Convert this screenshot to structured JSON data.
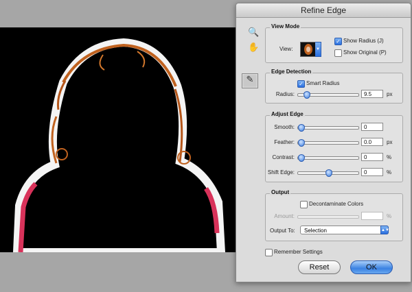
{
  "dialog": {
    "title": "Refine Edge"
  },
  "tools": [
    {
      "name": "zoom",
      "icon": "magnifier-icon",
      "glyph": "🔍"
    },
    {
      "name": "hand",
      "icon": "hand-icon",
      "glyph": "✋"
    },
    {
      "name": "refine-radius",
      "icon": "brush-icon",
      "glyph": "✎"
    }
  ],
  "view_mode": {
    "title": "View Mode",
    "view_label": "View:",
    "show_radius": {
      "label": "Show Radius (J)",
      "checked": true
    },
    "show_original": {
      "label": "Show Original (P)",
      "checked": false
    }
  },
  "edge_detection": {
    "title": "Edge Detection",
    "smart_radius": {
      "label": "Smart Radius",
      "checked": true
    },
    "radius": {
      "label": "Radius:",
      "value": "9.5",
      "unit": "px",
      "fraction": 0.1
    }
  },
  "adjust_edge": {
    "title": "Adjust Edge",
    "smooth": {
      "label": "Smooth:",
      "value": "0",
      "unit": "",
      "fraction": 0.0
    },
    "feather": {
      "label": "Feather:",
      "value": "0.0",
      "unit": "px",
      "fraction": 0.0
    },
    "contrast": {
      "label": "Contrast:",
      "value": "0",
      "unit": "%",
      "fraction": 0.0
    },
    "shift_edge": {
      "label": "Shift Edge:",
      "value": "0",
      "unit": "%",
      "fraction": 0.5
    }
  },
  "output": {
    "title": "Output",
    "decontaminate": {
      "label": "Decontaminate Colors",
      "checked": false
    },
    "amount": {
      "label": "Amount:",
      "value": "",
      "unit": "%"
    },
    "output_to": {
      "label": "Output To:",
      "selected": "Selection"
    }
  },
  "remember_settings": {
    "label": "Remember Settings",
    "checked": false
  },
  "buttons": {
    "reset": "Reset",
    "ok": "OK"
  },
  "colors": {
    "accent": "#2a6fe0",
    "canvas_bg": "#a6a6a6",
    "hair": "#c0621f",
    "shirt": "#d8325a"
  }
}
